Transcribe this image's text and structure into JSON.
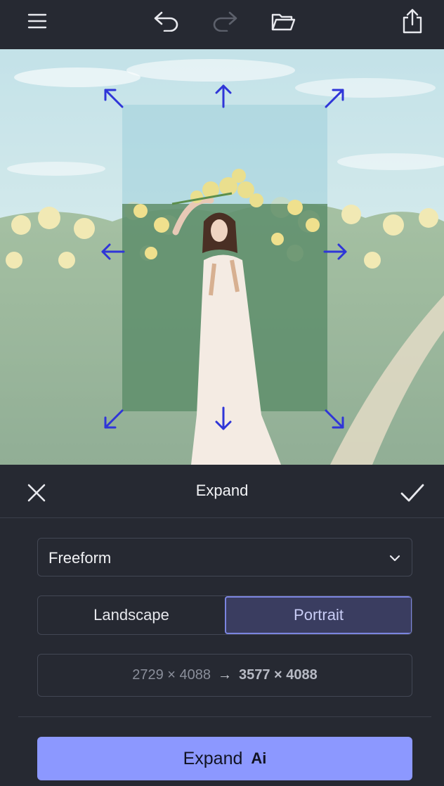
{
  "toolbar": {
    "menu_icon": "hamburger-menu-icon",
    "undo_icon": "undo-icon",
    "redo_icon": "redo-icon",
    "open_icon": "open-folder-icon",
    "share_icon": "share-export-icon",
    "redo_enabled": false
  },
  "canvas": {
    "handle_color": "#2f35d8",
    "handle_icons": [
      "arrow-up-left-icon",
      "arrow-up-icon",
      "arrow-up-right-icon",
      "arrow-left-icon",
      "arrow-right-icon",
      "arrow-down-left-icon",
      "arrow-down-icon",
      "arrow-down-right-icon"
    ]
  },
  "panel": {
    "title": "Expand",
    "close_icon": "close-icon",
    "confirm_icon": "checkmark-icon",
    "aspect_select": {
      "selected": "Freeform"
    },
    "orientation": {
      "options": [
        "Landscape",
        "Portrait"
      ],
      "selected": "Portrait"
    },
    "dimensions": {
      "from": "2729 × 4088",
      "to": "3577 × 4088"
    },
    "expand_button": {
      "label": "Expand",
      "ai_label": "Ai"
    }
  },
  "colors": {
    "background": "#262932",
    "accent": "#8c98ff",
    "selected_segment": "#3a3d60"
  }
}
